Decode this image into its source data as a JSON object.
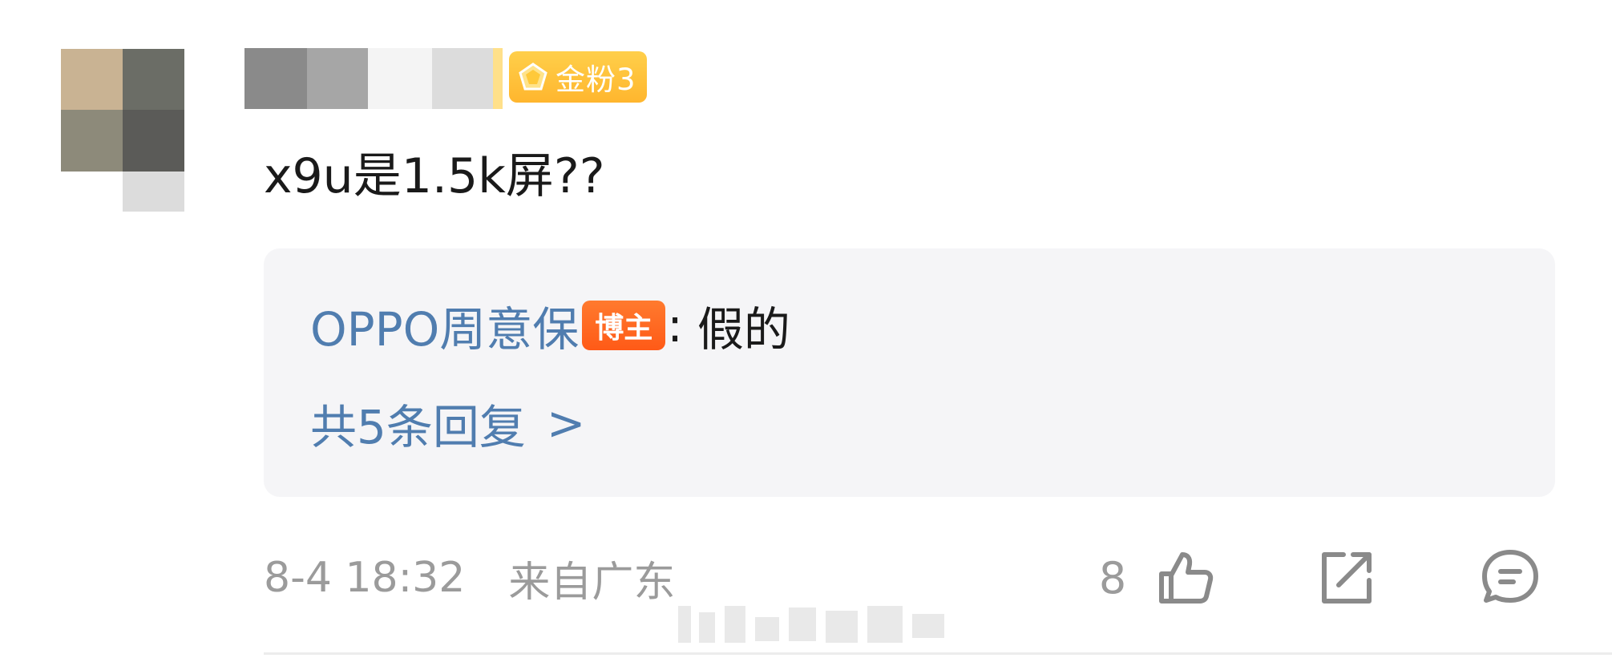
{
  "comment": {
    "fan_badge": {
      "label": "金粉3",
      "color": "#ffb62e",
      "icon": "diamond-icon"
    },
    "text": "x9u是1.5k屏??",
    "reply": {
      "author": "OPPO周意保",
      "author_badge": "博主",
      "separator": ":",
      "content": "假的",
      "count_label": "共5条回复",
      "chevron": ">"
    },
    "meta": {
      "timestamp": "8-4 18:32",
      "location": "来自广东"
    },
    "actions": {
      "like_count": "8"
    }
  },
  "colors": {
    "link_blue": "#507daf",
    "meta_gray": "#9b9b9b",
    "reply_bg": "#f5f5f7",
    "blogger_badge": "#ff5a17"
  }
}
